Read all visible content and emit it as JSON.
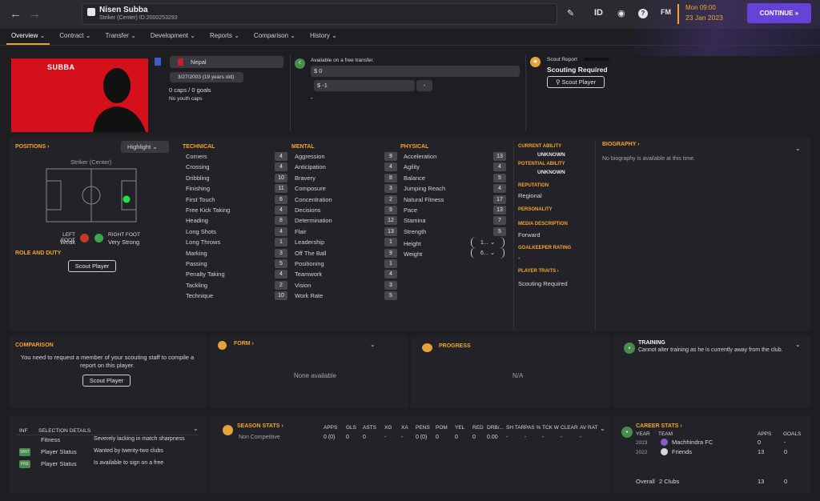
{
  "header": {
    "player_name": "Nisen Subba",
    "player_sub": "Striker (Center) ID:2000253293",
    "icon_id": "ID",
    "icon_fm": "FM",
    "date_time": "Mon 09:00",
    "date_day": "23 Jan 2023",
    "continue": "CONTINUE"
  },
  "tabs": [
    "Overview",
    "Contract",
    "Transfer",
    "Development",
    "Reports",
    "Comparison",
    "History"
  ],
  "profile": {
    "name_label": "SUBBA",
    "nation": "Nepal",
    "dob": "3/27/2003 (19 years old)",
    "caps": "0 caps / 0 goals",
    "youth_caps": "No youth caps",
    "transfer_status": "Available on a free transfer.",
    "value1": "$ 0",
    "value2": "$ -1",
    "dash": "-",
    "scout_report_label": "Scout Report",
    "scout_required": "Scouting Required",
    "scout_player": "Scout Player"
  },
  "positions": {
    "title": "POSITIONS",
    "highlight": "Highlight",
    "position_name": "Striker (Center)",
    "left_foot_label": "LEFT FOOT",
    "left_foot_value": "Weak",
    "right_foot_label": "RIGHT FOOT",
    "right_foot_value": "Very Strong",
    "role_title": "ROLE AND DUTY",
    "scout_player": "Scout Player"
  },
  "technical": {
    "title": "TECHNICAL",
    "items": [
      {
        "label": "Corners",
        "value": "4"
      },
      {
        "label": "Crossing",
        "value": "4"
      },
      {
        "label": "Dribbling",
        "value": "10"
      },
      {
        "label": "Finishing",
        "value": "11"
      },
      {
        "label": "First Touch",
        "value": "6"
      },
      {
        "label": "Free Kick Taking",
        "value": "4"
      },
      {
        "label": "Heading",
        "value": "8"
      },
      {
        "label": "Long Shots",
        "value": "4"
      },
      {
        "label": "Long Throws",
        "value": "1"
      },
      {
        "label": "Marking",
        "value": "3"
      },
      {
        "label": "Passing",
        "value": "5"
      },
      {
        "label": "Penalty Taking",
        "value": "4"
      },
      {
        "label": "Tackling",
        "value": "2"
      },
      {
        "label": "Technique",
        "value": "10"
      }
    ]
  },
  "mental": {
    "title": "MENTAL",
    "items": [
      {
        "label": "Aggression",
        "value": "9"
      },
      {
        "label": "Anticipation",
        "value": "4"
      },
      {
        "label": "Bravery",
        "value": "8"
      },
      {
        "label": "Composure",
        "value": "3"
      },
      {
        "label": "Concentration",
        "value": "2"
      },
      {
        "label": "Decisions",
        "value": "9"
      },
      {
        "label": "Determination",
        "value": "12"
      },
      {
        "label": "Flair",
        "value": "13"
      },
      {
        "label": "Leadership",
        "value": "1"
      },
      {
        "label": "Off The Ball",
        "value": "9"
      },
      {
        "label": "Positioning",
        "value": "1"
      },
      {
        "label": "Teamwork",
        "value": "4"
      },
      {
        "label": "Vision",
        "value": "3"
      },
      {
        "label": "Work Rate",
        "value": "5"
      }
    ]
  },
  "physical": {
    "title": "PHYSICAL",
    "items": [
      {
        "label": "Acceleration",
        "value": "13"
      },
      {
        "label": "Agility",
        "value": "4"
      },
      {
        "label": "Balance",
        "value": "5"
      },
      {
        "label": "Jumping Reach",
        "value": "4"
      },
      {
        "label": "Natural Fitness",
        "value": "17"
      },
      {
        "label": "Pace",
        "value": "13"
      },
      {
        "label": "Stamina",
        "value": "7"
      },
      {
        "label": "Strength",
        "value": "5"
      }
    ],
    "height_label": "Height",
    "height_value": "1...",
    "weight_label": "Weight",
    "weight_value": "6..."
  },
  "info": {
    "ca_label": "CURRENT ABILITY",
    "ca_value": "UNKNOWN",
    "pa_label": "POTENTIAL ABILITY",
    "pa_value": "UNKNOWN",
    "rep_label": "REPUTATION",
    "rep_value": "Regional",
    "pers_label": "PERSONALITY",
    "media_label": "MEDIA DESCRIPTION",
    "media_value": "Forward",
    "gk_label": "GOALKEEPER RATING",
    "gk_value": "-",
    "traits_label": "PLAYER TRAITS",
    "traits_value": "Scouting Required"
  },
  "bio": {
    "title": "BIOGRAPHY",
    "text": "No biography is available at this time."
  },
  "comparison": {
    "title": "COMPARISON",
    "text": "You need to request a member of your scouting staff to compile a report on this player.",
    "button": "Scout Player"
  },
  "form": {
    "title": "FORM",
    "empty": "None available"
  },
  "progress": {
    "title": "PROGRESS",
    "empty": "N/A"
  },
  "training": {
    "title": "TRAINING",
    "text": "Cannot alter training as he is currently away from the club."
  },
  "selection": {
    "inf": "INF",
    "title": "SELECTION DETAILS",
    "rows": [
      {
        "label": "Fitness",
        "value": "Severely lacking in match sharpness"
      },
      {
        "label": "Player Status",
        "value": "Wanted by twenty-two clubs"
      },
      {
        "label": "Player Status",
        "value": "Is available to sign on a free"
      }
    ]
  },
  "season": {
    "title": "SEASON STATS",
    "headers": [
      "APPS",
      "GLS",
      "ASTS",
      "XG",
      "XA",
      "PENS",
      "POM",
      "YEL",
      "RED",
      "DRB/...",
      "SH TAR",
      "PAS %",
      "TCK W",
      "CLEAR",
      "AV RAT"
    ],
    "row_label": "Non Competitive",
    "row": [
      "0 (0)",
      "0",
      "0",
      "-",
      "-",
      "0 (0)",
      "0",
      "0",
      "0",
      "0.00",
      "-",
      "-",
      "-",
      "-",
      "-"
    ]
  },
  "career": {
    "title": "CAREER STATS",
    "year_header": "YEAR",
    "team_header": "TEAM",
    "apps_header": "APPS",
    "goals_header": "GOALS",
    "rows": [
      {
        "year": "2023",
        "team": "Machhindra FC",
        "apps": "0",
        "goals": "-"
      },
      {
        "year": "2022",
        "team": "Friends",
        "apps": "13",
        "goals": "0"
      }
    ],
    "overall_label": "Overall",
    "overall_clubs": "2 Clubs",
    "overall_apps": "13",
    "overall_goals": "0"
  },
  "colors": {
    "accent": "#f2a52a",
    "continue": "#6742d9",
    "foot_weak": "#c0392b",
    "foot_strong": "#3aa64a",
    "position_dot": "#2ed84b"
  }
}
